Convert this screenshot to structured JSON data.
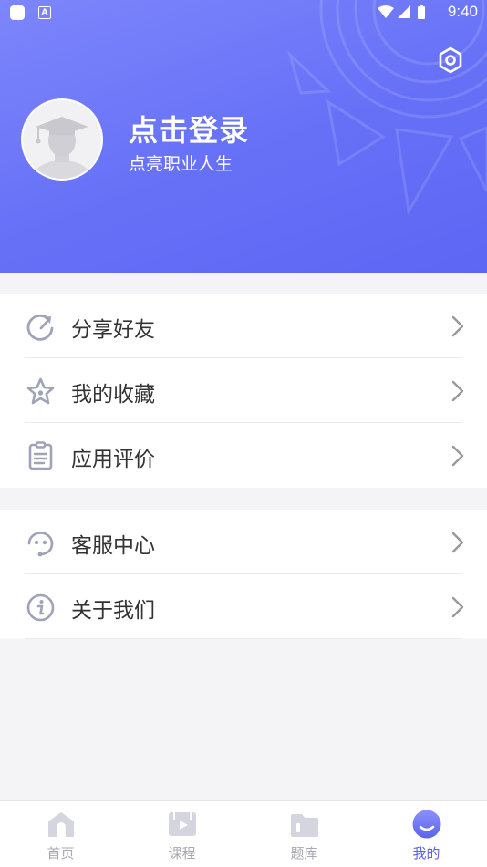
{
  "status_bar": {
    "time": "9:40"
  },
  "profile": {
    "title": "点击登录",
    "subtitle": "点亮职业人生"
  },
  "menu_group_1": [
    {
      "label": "分享好友",
      "icon": "share-icon"
    },
    {
      "label": "我的收藏",
      "icon": "star-icon"
    },
    {
      "label": "应用评价",
      "icon": "clipboard-icon"
    }
  ],
  "menu_group_2": [
    {
      "label": "客服中心",
      "icon": "headset-icon"
    },
    {
      "label": "关于我们",
      "icon": "info-icon"
    }
  ],
  "tabs": [
    {
      "label": "首页",
      "icon": "home-icon"
    },
    {
      "label": "课程",
      "icon": "course-video-icon"
    },
    {
      "label": "题库",
      "icon": "question-bank-icon"
    },
    {
      "label": "我的",
      "icon": "profile-icon",
      "active": true
    }
  ],
  "colors": {
    "header_start": "#7d86fb",
    "header_end": "#5d66f3",
    "accent": "#5d63e8",
    "icon_gray": "#9ea3b8"
  }
}
